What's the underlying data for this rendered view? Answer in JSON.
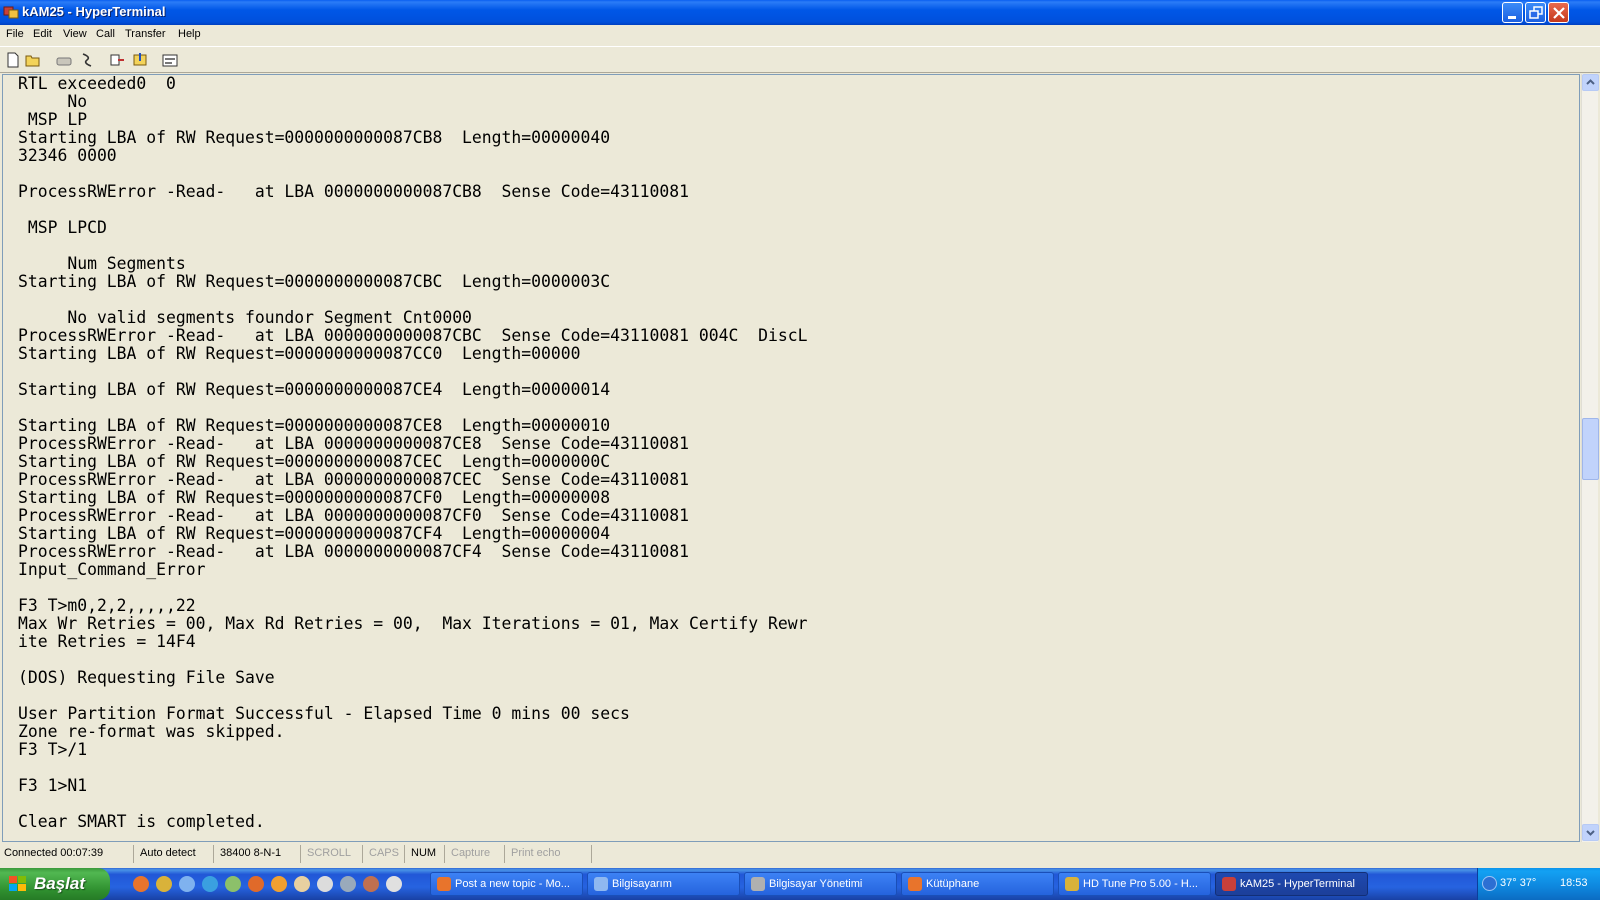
{
  "window": {
    "title": "kAM25 - HyperTerminal"
  },
  "menu": {
    "items": [
      "File",
      "Edit",
      "View",
      "Call",
      "Transfer",
      "Help"
    ]
  },
  "toolbar": {
    "icons": [
      "new-icon",
      "open-icon",
      "connect-icon",
      "disconnect-icon",
      "send-icon",
      "receive-icon",
      "properties-icon"
    ]
  },
  "terminal": {
    "lines": [
      "RTL exceeded0  0",
      "     No",
      " MSP LP",
      "Starting LBA of RW Request=0000000000087CB8  Length=00000040",
      "32346 0000",
      "",
      "ProcessRWError -Read-   at LBA 0000000000087CB8  Sense Code=43110081",
      "",
      " MSP LPCD",
      "",
      "     Num Segments",
      "Starting LBA of RW Request=0000000000087CBC  Length=0000003C",
      "",
      "     No valid segments foundor Segment Cnt0000",
      "ProcessRWError -Read-   at LBA 0000000000087CBC  Sense Code=43110081 004C  DiscL",
      "Starting LBA of RW Request=0000000000087CC0  Length=00000",
      "",
      "Starting LBA of RW Request=0000000000087CE4  Length=00000014",
      "",
      "Starting LBA of RW Request=0000000000087CE8  Length=00000010",
      "ProcessRWError -Read-   at LBA 0000000000087CE8  Sense Code=43110081",
      "Starting LBA of RW Request=0000000000087CEC  Length=0000000C",
      "ProcessRWError -Read-   at LBA 0000000000087CEC  Sense Code=43110081",
      "Starting LBA of RW Request=0000000000087CF0  Length=00000008",
      "ProcessRWError -Read-   at LBA 0000000000087CF0  Sense Code=43110081",
      "Starting LBA of RW Request=0000000000087CF4  Length=00000004",
      "ProcessRWError -Read-   at LBA 0000000000087CF4  Sense Code=43110081",
      "Input_Command_Error",
      "",
      "F3 T>m0,2,2,,,,,22",
      "Max Wr Retries = 00, Max Rd Retries = 00,  Max Iterations = 01, Max Certify Rewr",
      "ite Retries = 14F4",
      "",
      "(DOS) Requesting File Save",
      "",
      "User Partition Format Successful - Elapsed Time 0 mins 00 secs",
      "Zone re-format was skipped.",
      "F3 T>/1",
      "",
      "F3 1>N1",
      "",
      "Clear SMART is completed."
    ]
  },
  "statusbar": {
    "connected": "Connected 00:07:39",
    "detect": "Auto detect",
    "settings": "38400 8-N-1",
    "scroll": "SCROLL",
    "caps": "CAPS",
    "num": "NUM",
    "capture": "Capture",
    "print_echo": "Print echo"
  },
  "taskbar": {
    "start_label": "Başlat",
    "tasks": [
      {
        "label": "Post a new topic - Mo...",
        "color": "#e8742c"
      },
      {
        "label": "Bilgisayarım",
        "color": "#8fb8f0"
      },
      {
        "label": "Bilgisayar Yönetimi",
        "color": "#b0b0b0"
      },
      {
        "label": "Kütüphane",
        "color": "#e8742c"
      },
      {
        "label": "HD Tune Pro 5.00 - H...",
        "color": "#d9b23a"
      },
      {
        "label": "kAM25 - HyperTerminal",
        "color": "#c8403a"
      }
    ],
    "tray_temp": "37° 37°",
    "clock": "18:53"
  }
}
